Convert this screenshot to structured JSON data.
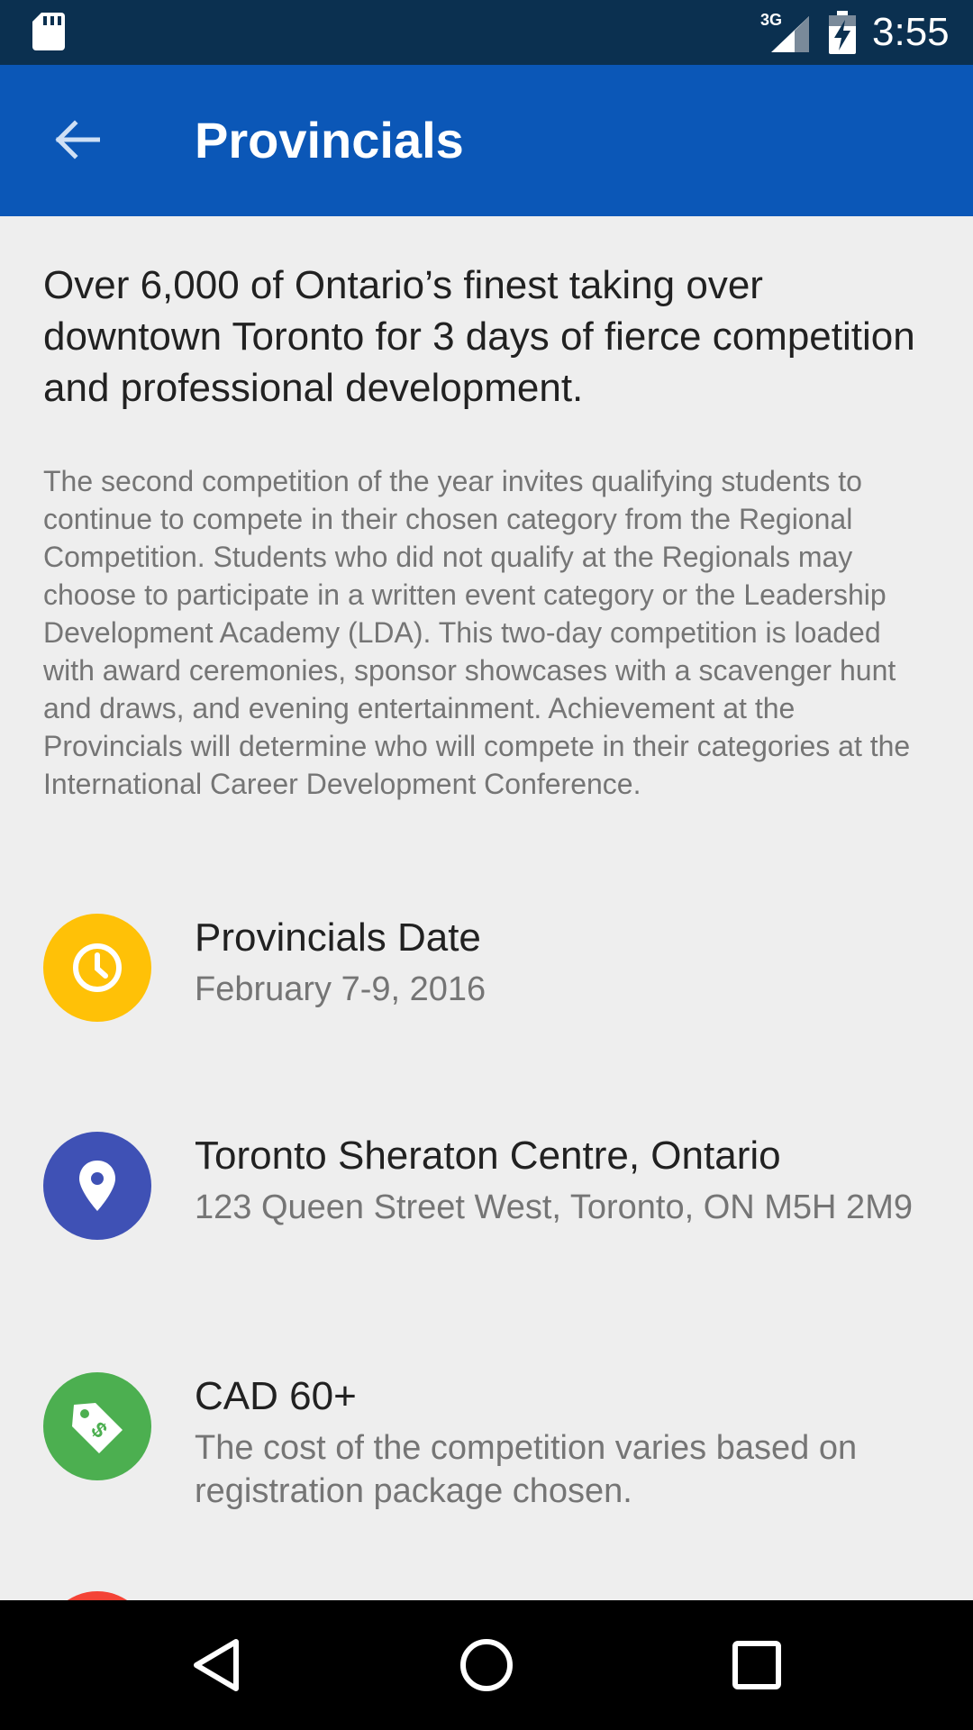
{
  "status_bar": {
    "time": "3:55",
    "network": "3G",
    "icons": [
      "sd-card-icon",
      "signal-icon",
      "battery-charging-icon"
    ]
  },
  "app_bar": {
    "title": "Provincials",
    "back_icon": "arrow-back-icon",
    "color": "#0b57b7"
  },
  "content": {
    "headline": "Over 6,000 of Ontario’s finest taking over downtown Toronto for 3 days of fierce competition and professional development.",
    "description": "The second competition of the year invites qualifying students to continue to compete in their chosen category from the Regional Competition. Students who did not qualify at the Regionals may choose to participate in a written event category or the Leadership Development Academy (LDA). This two-day competition is loaded with award ceremonies, sponsor showcases with a scavenger hunt and draws, and evening entertainment. Achievement at the Provincials will determine who will compete in their categories at the International Career Development Conference."
  },
  "info_items": [
    {
      "icon": "clock-icon",
      "color": "#ffc107",
      "title": "Provincials Date",
      "subtitle": "February 7-9, 2016"
    },
    {
      "icon": "location-pin-icon",
      "color": "#3f51b5",
      "title": "Toronto Sheraton Centre, Ontario",
      "subtitle": "123 Queen Street West, Toronto, ON M5H 2M9"
    },
    {
      "icon": "price-tag-icon",
      "color": "#4caf50",
      "title": "CAD 60+",
      "subtitle": "The cost of the competition varies based on registration package chosen."
    }
  ],
  "nav_bar": {
    "buttons": [
      "back-triangle-icon",
      "home-circle-icon",
      "recents-square-icon"
    ]
  }
}
